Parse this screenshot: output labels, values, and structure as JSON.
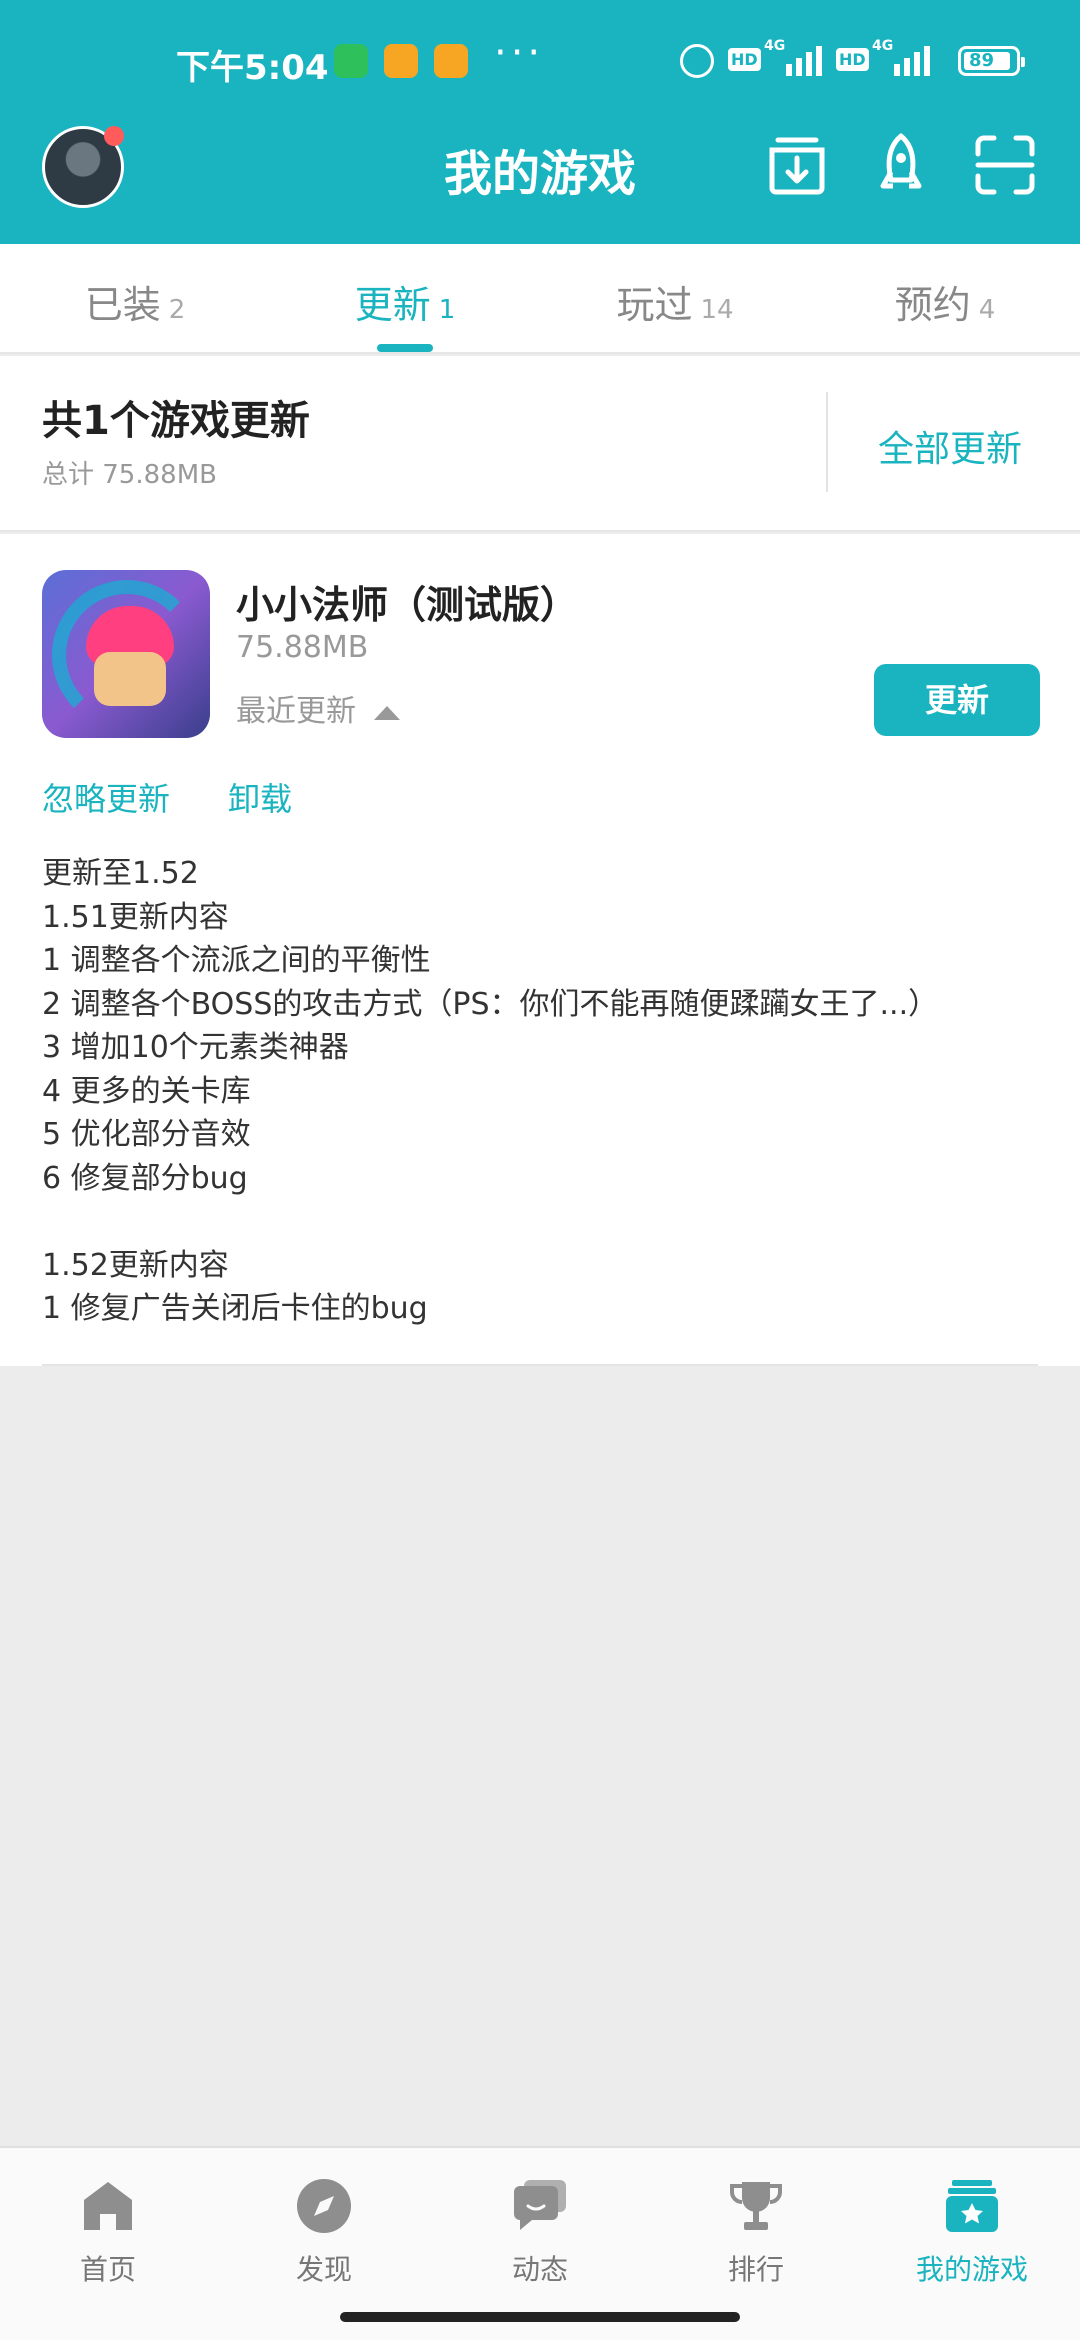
{
  "status_bar": {
    "time": "下午5:04",
    "network1": "4G",
    "network2": "4G",
    "hd1": "HD",
    "hd2": "HD",
    "battery": "89",
    "more": "···"
  },
  "header": {
    "title": "我的游戏",
    "icons": [
      "download-icon",
      "rocket-icon",
      "scan-icon"
    ]
  },
  "tabs": [
    {
      "label": "已装",
      "count": "2"
    },
    {
      "label": "更新",
      "count": "1"
    },
    {
      "label": "玩过",
      "count": "14"
    },
    {
      "label": "预约",
      "count": "4"
    }
  ],
  "active_tab": 1,
  "summary": {
    "title": "共1个游戏更新",
    "subtitle": "总计  75.88MB",
    "update_all": "全部更新"
  },
  "game": {
    "name": "小小法师（测试版）",
    "size": "75.88MB",
    "recent": "最近更新",
    "update_button": "更新",
    "ignore": "忽略更新",
    "uninstall": "卸载",
    "changelog": [
      "更新至1.52",
      "1.51更新内容",
      "1 调整各个流派之间的平衡性",
      "2 调整各个BOSS的攻击方式（PS：你们不能再随便蹂躏女王了...）",
      "3 增加10个元素类神器",
      "4 更多的关卡库",
      "5 优化部分音效",
      "6 修复部分bug",
      "",
      "1.52更新内容",
      "1 修复广告关闭后卡住的bug"
    ]
  },
  "bottom_nav": [
    {
      "label": "首页",
      "icon": "home-icon"
    },
    {
      "label": "发现",
      "icon": "compass-icon"
    },
    {
      "label": "动态",
      "icon": "chat-icon"
    },
    {
      "label": "排行",
      "icon": "trophy-icon"
    },
    {
      "label": "我的游戏",
      "icon": "my-games-icon"
    }
  ],
  "colors": {
    "accent": "#19b4bf",
    "background": "#ececec"
  }
}
